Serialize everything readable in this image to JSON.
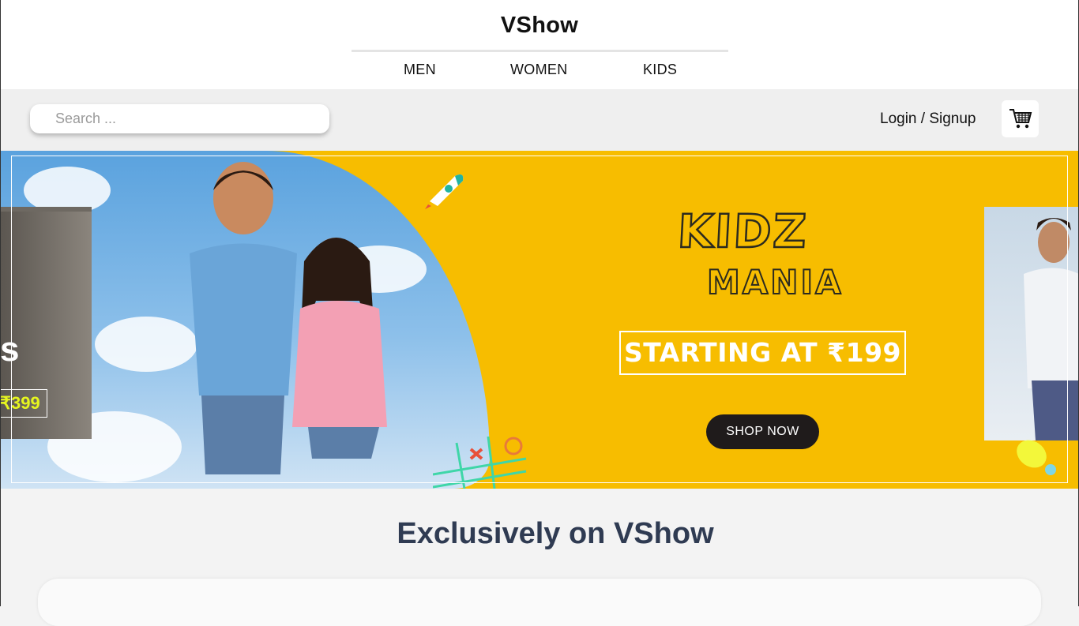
{
  "header": {
    "logo": "VShow",
    "nav": [
      "MEN",
      "WOMEN",
      "KIDS"
    ]
  },
  "toolbar": {
    "search_placeholder": "Search ...",
    "login_label": "Login / Signup",
    "cart_icon": "cart-icon"
  },
  "banner": {
    "left_card": {
      "fragment": "s",
      "price": "₹399"
    },
    "title_line1": "KIDZ",
    "title_line2": "MANIA",
    "offer": "STARTING AT ₹199",
    "cta": "SHOP NOW",
    "colors": {
      "background": "#f7bd00",
      "sky": "#5aa2de"
    }
  },
  "section": {
    "title": "Exclusively on VShow"
  }
}
